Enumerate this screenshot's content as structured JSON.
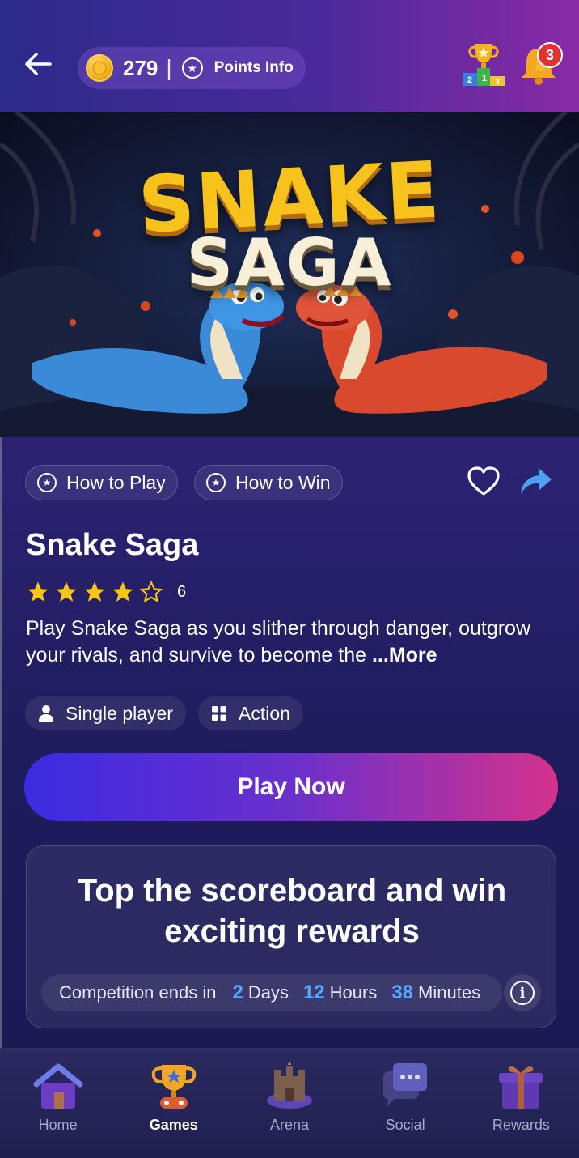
{
  "header": {
    "coins": "279",
    "divider": "|",
    "points_info_label": "Points Info",
    "notification_count": "3"
  },
  "banner": {
    "title_line1": "SNAKE",
    "title_line2": "SAGA"
  },
  "actions": {
    "how_to_play": "How to Play",
    "how_to_win": "How to Win"
  },
  "game": {
    "title": "Snake Saga",
    "rating": 4,
    "rating_max": 5,
    "rating_count": "6",
    "description": "Play Snake Saga as you slither through danger, outgrow your rivals, and survive to become the ",
    "more_label": "...More",
    "tags": {
      "mode": "Single player",
      "genre": "Action"
    },
    "play_label": "Play Now"
  },
  "promo": {
    "heading_line1": "Top the scoreboard and win",
    "heading_line2": "exciting rewards",
    "countdown_prefix": "Competition ends in",
    "days_value": "2",
    "days_label": "Days",
    "hours_value": "12",
    "hours_label": "Hours",
    "minutes_value": "38",
    "minutes_label": "Minutes",
    "info_glyph": "i"
  },
  "nav": {
    "home": "Home",
    "games": "Games",
    "arena": "Arena",
    "social": "Social",
    "rewards": "Rewards",
    "active": "games"
  },
  "colors": {
    "accent_blue": "#56a7ff",
    "play_gradient_start": "#3b2be0",
    "play_gradient_end": "#d3328c",
    "star": "#f5c518",
    "badge_red": "#e23131"
  }
}
